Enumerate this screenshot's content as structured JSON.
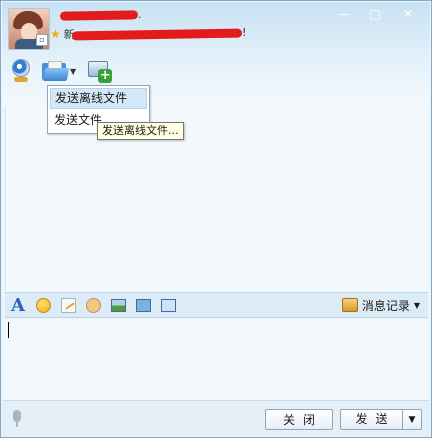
{
  "window": {
    "controls": {
      "minimize": "—",
      "maximize": "□",
      "close": "✕"
    }
  },
  "contact": {
    "name_tail": ".",
    "signature_prefix": "新",
    "signature_tail": "!"
  },
  "menu": {
    "items": [
      {
        "label": "发送离线文件"
      },
      {
        "label": "发送文件"
      }
    ],
    "tooltip": "发送离线文件..."
  },
  "format_bar": {
    "font_glyph": "A",
    "history_label": "消息记录",
    "history_caret": "▼"
  },
  "bottom": {
    "close_label": "关闭",
    "send_label": "发送",
    "send_dropdown": "▼"
  },
  "colors": {
    "accent": "#2a62b8",
    "header": "#c8e2f3",
    "redaction": "#e41b1b"
  }
}
